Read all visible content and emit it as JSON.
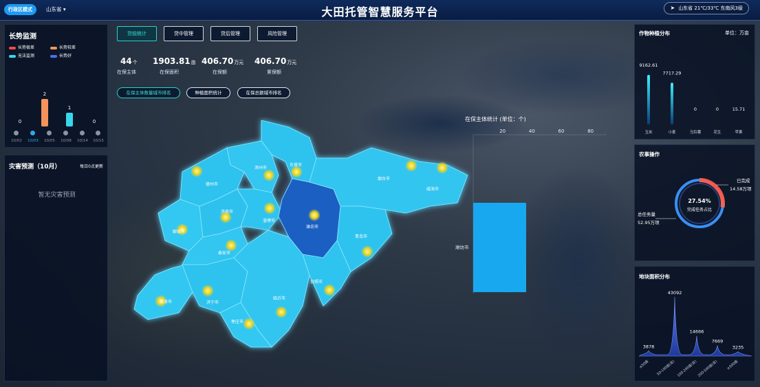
{
  "header": {
    "mode": "行政区模式",
    "province": "山东省",
    "title": "大田托管智慧服务平台",
    "weather": "山东省  21℃/33℃ 东南风3级"
  },
  "growth": {
    "title": "长势监测",
    "legend": [
      "长势极差",
      "长势较差",
      "无法监测",
      "长势好"
    ],
    "values": [
      "0",
      "2",
      "1",
      "0"
    ],
    "dates": [
      "10/02",
      "10/03",
      "10/05",
      "10/08",
      "10/14",
      "10/15"
    ]
  },
  "disaster": {
    "title": "灾害预测（10月）",
    "update": "每日0点更新",
    "empty": "暂无灾害预测"
  },
  "tabs": [
    "贷前统计",
    "贷中管理",
    "贷后管理",
    "风险管理"
  ],
  "stats": [
    {
      "num": "44",
      "unit": "个",
      "label": "在保主体"
    },
    {
      "num": "1903.81",
      "unit": "亩",
      "label": "在保面积"
    },
    {
      "num": "406.70",
      "unit": "万元",
      "label": "在保额"
    },
    {
      "num": "406.70",
      "unit": "万元",
      "label": "累保额"
    }
  ],
  "pills": [
    "在保主体数量城市排名",
    "种植面积统计",
    "在保总额城市排名"
  ],
  "map": {
    "cities": [
      "德州市",
      "滨州市",
      "东营市",
      "烟台市",
      "威海市",
      "济南市",
      "淄博市",
      "潍坊市",
      "聊城市",
      "泰安市",
      "青岛市",
      "济宁市",
      "临沂市",
      "日照市",
      "菏泽市",
      "枣庄市"
    ]
  },
  "chart_data": [
    {
      "type": "bar",
      "title": "在保主体统计 (单位：个)",
      "orientation": "horizontal",
      "categories": [
        "潍坊市"
      ],
      "values": [
        44
      ],
      "xticks": [
        "20",
        "40",
        "60",
        "80"
      ],
      "color": "#17a8f0"
    },
    {
      "type": "bar",
      "title": "作物种植分布",
      "unit": "单位：万亩",
      "categories": [
        "玉米",
        "小麦",
        "马铃薯",
        "花生",
        "苹果"
      ],
      "values": [
        9162.61,
        7717.29,
        0,
        0,
        15.71
      ],
      "labels": [
        "9162.61",
        "7717.29",
        "0",
        "0",
        "15.71"
      ]
    },
    {
      "type": "pie",
      "title": "农事操作",
      "center_value": "27.54%",
      "center_label": "完成任务占比",
      "done_label": "已完成",
      "done_value": "14.58万项",
      "total_label": "总任务量",
      "total_value": "52.95万项"
    },
    {
      "type": "area",
      "title": "地块面积分布",
      "categories": [
        "≤50亩",
        "50-100亩(含)",
        "100-200亩(含)",
        "200-500亩(含)",
        "≥500亩"
      ],
      "values": [
        3878,
        43092,
        14666,
        7669,
        3235
      ],
      "labels": [
        "3878",
        "43092",
        "14666",
        "7669",
        "3235"
      ]
    }
  ]
}
